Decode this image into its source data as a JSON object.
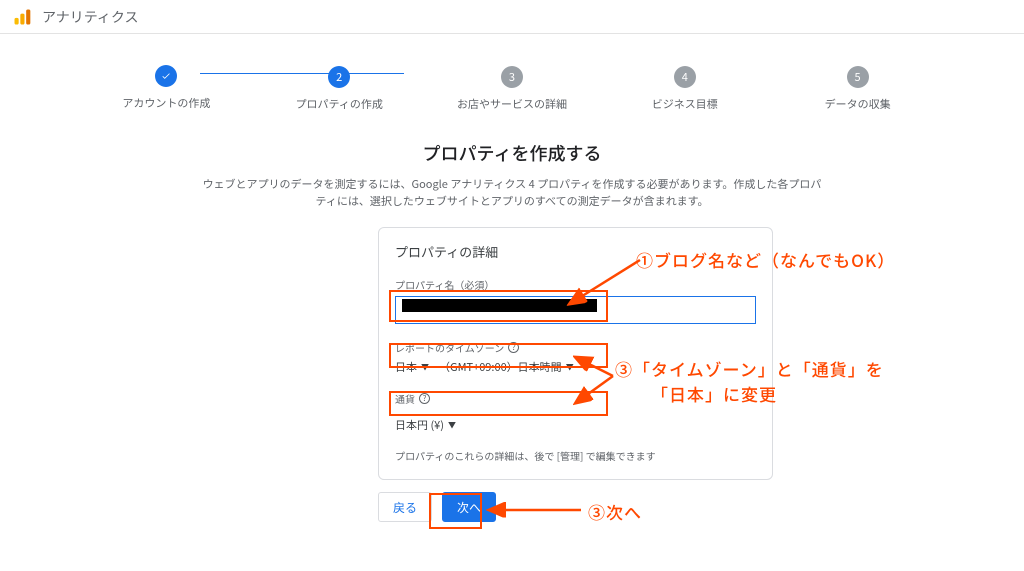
{
  "header": {
    "title": "アナリティクス"
  },
  "stepper": {
    "steps": [
      {
        "num": "✓",
        "label": "アカウントの作成"
      },
      {
        "num": "2",
        "label": "プロパティの作成"
      },
      {
        "num": "3",
        "label": "お店やサービスの詳細"
      },
      {
        "num": "4",
        "label": "ビジネス目標"
      },
      {
        "num": "5",
        "label": "データの収集"
      }
    ]
  },
  "headline": "プロパティを作成する",
  "subtext": "ウェブとアプリのデータを測定するには、Google アナリティクス 4 プロパティを作成する必要があります。作成した各プロパティには、選択したウェブサイトとアプリのすべての測定データが含まれます。",
  "card": {
    "title": "プロパティの詳細",
    "prop_name_label": "プロパティ名（必須）",
    "tz_label": "レポートのタイムゾーン",
    "tz_country": "日本",
    "tz_value": "（GMT+09:00）日本時間",
    "currency_label": "通貨",
    "currency_value": "日本円 (¥)",
    "note": "プロパティのこれらの詳細は、後で [管理] で編集できます"
  },
  "buttons": {
    "back": "戻る",
    "next": "次へ"
  },
  "annotations": {
    "a1": "①ブログ名など（なんでもOK）",
    "a3a": "③「タイムゾーン」と「通貨」を",
    "a3b": "「日本」に変更",
    "a_next": "③次へ"
  }
}
